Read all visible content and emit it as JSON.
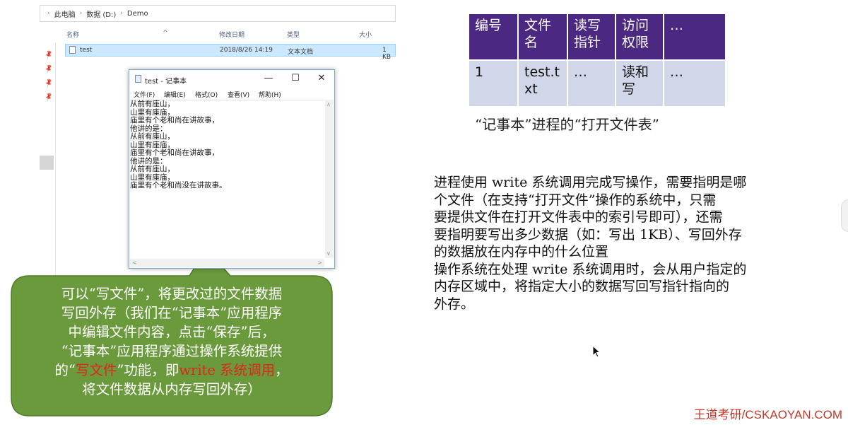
{
  "explorer": {
    "breadcrumb": [
      "此电脑",
      "数据 (D:)",
      "Demo"
    ],
    "columns": {
      "name": "名称",
      "modified": "修改日期",
      "type": "类型",
      "size": "大小"
    },
    "file": {
      "name": "test",
      "modified": "2018/8/26 14:19",
      "type": "文本文档",
      "size": "1 KB"
    }
  },
  "notepad": {
    "title": "test - 记事本",
    "menu": [
      "文件(F)",
      "编辑(E)",
      "格式(O)",
      "查看(V)",
      "帮助(H)"
    ],
    "lines": [
      "从前有座山，",
      "山里有座庙，",
      "庙里有个老和尚在讲故事，",
      "他讲的是：",
      "从前有座山，",
      "山里有座庙，",
      "庙里有个老和尚在讲故事，",
      "他讲的是：",
      "从前有座山，",
      "山里有座庙，",
      "庙里有个老和尚没在讲故事。"
    ]
  },
  "callout": {
    "line1": "可以“写文件”，将更改过的文件数据",
    "line2": "写回外存（我们在“记事本”应用程序",
    "line3": "中编辑文件内容，点击“保存”后，",
    "line4": "“记事本”应用程序通过操作系统提供",
    "line5_a": "的“",
    "line5_hl1": "写文件",
    "line5_b": "”功能，即",
    "line5_hl2": "write 系统调用",
    "line5_c": "，",
    "line6": "将文件数据从内存写回外存）",
    "fill_color": "#6a9a3c",
    "highlight_color": "#e0251b"
  },
  "table": {
    "headers": [
      "编号",
      "文件名",
      "读写指针",
      "访问权限",
      "…"
    ],
    "row": [
      "1",
      "test.txt",
      "…",
      "读和写",
      "…"
    ],
    "caption": "“记事本”进程的“打开文件表”",
    "header_color": "#4b2882",
    "row_color": "#d2d6e9"
  },
  "paragraphs": {
    "p1_lines": [
      "进程使用 write 系统调用完成写操作，需要指明是哪",
      "个文件（在支持“打开文件”操作的系统中，只需",
      "要提供文件在打开文件表中的索引号即可），还需",
      "要指明要写出多少数据（如：写出 1KB）、写回外存",
      "的数据放在内存中的什么位置"
    ],
    "p2_lines": [
      "操作系统在处理 write 系统调用时，会从用户指定的",
      "内存区域中，将指定大小的数据写回写指针指向的",
      "外存。"
    ]
  },
  "watermark": "王道考研/CSKAOYAN.COM"
}
